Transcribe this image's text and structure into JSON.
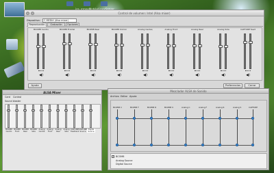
{
  "desktop": {
    "top_label": "ice_ozoneMobileLinuxServer"
  },
  "win_mixer": {
    "title": "Control de volumen: Intel (Alsa mixer)",
    "device_label": "Dispositivo:",
    "device_value": "C-MEDIA (Alsa mixer)",
    "tabs": [
      "Reproducción",
      "Grabación",
      "Opciones"
    ],
    "channels": [
      "BCOM8 Centro/LFE",
      "BCOM8 Frontal",
      "BCOM8 Rear",
      "BCOM8 Unknown",
      "Analog Center/LFE",
      "Analog Front",
      "Analog Rear",
      "Analog Side",
      "CAPTURE feedback"
    ],
    "help_label": "Ayuda",
    "prefs_label": "Preferencias",
    "close_label": "Cerrar"
  },
  "win_alsa": {
    "title": "ALSA Mixer",
    "menu": [
      "Card",
      "Control"
    ],
    "card_label": "Sound blaster",
    "channels": [
      "BCOM8 Centro",
      "BCOM8 Front",
      "BCOM8 Rear",
      "BCOM8 Side",
      "Analog Centre",
      "Analog Front",
      "Analog Rear",
      "Analog Side",
      "CAPTURE Feedback",
      "CAPTURE Source",
      "Digital Source"
    ]
  },
  "win_ctrl": {
    "title": "Mezclador ALSA de Sonido",
    "menu": [
      "Archivo",
      "Editar",
      "Ayuda"
    ],
    "columns": [
      "BCOM8 C",
      "BCOM8 F",
      "BCOM8 R",
      "BCOM8 U",
      "Analog C",
      "Analog F",
      "Analog R",
      "Analog S",
      "CAPTURE"
    ],
    "checkbox_label": "BCOM8",
    "items": [
      "Analog Source",
      "Digital Source"
    ]
  }
}
